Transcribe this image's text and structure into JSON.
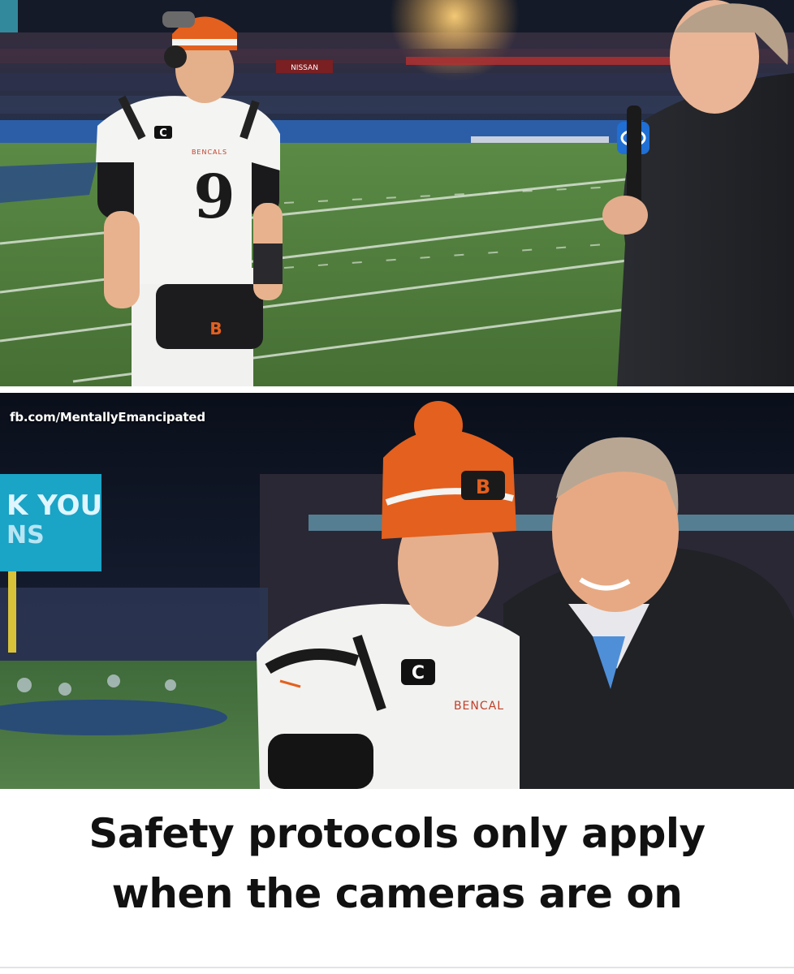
{
  "watermark": {
    "text": "fb.com/MentallyEmancipated"
  },
  "caption": {
    "line1": "Safety protocols only apply",
    "line2": "when the cameras are on"
  },
  "top_photo": {
    "jersey_team": "BENCALS",
    "jersey_number": "9",
    "jersey_patch": "C",
    "stadium_sign": "NISSAN",
    "mic_flag_logo": "cbs-eye-logo"
  },
  "bottom_photo": {
    "scoreboard_text_line1": "K YOU",
    "scoreboard_text_line2": "NS",
    "jersey_team": "BENCAL",
    "jersey_patch": "C"
  },
  "colors": {
    "bengals_orange": "#e4601e",
    "field_green": "#4c7a3a",
    "titans_blue": "#2a6fbf",
    "caption_text": "#111111"
  }
}
